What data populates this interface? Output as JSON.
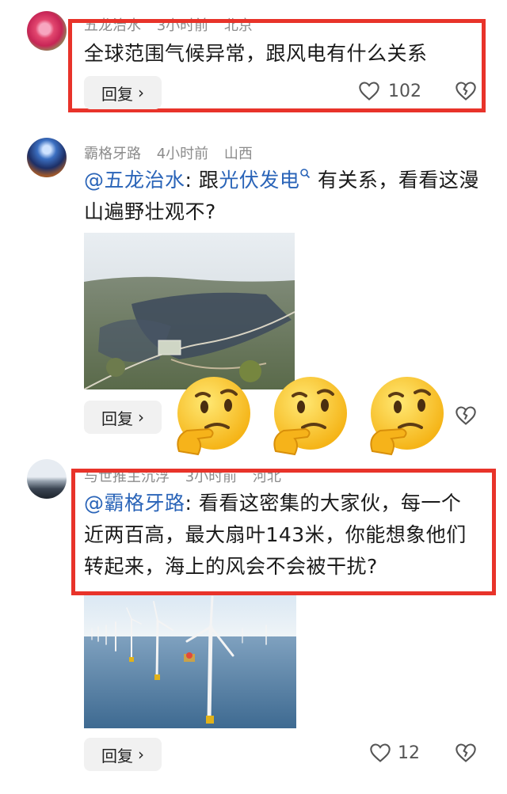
{
  "comments": [
    {
      "user": "五龙治水",
      "time": "3小时前",
      "location": "北京",
      "text": "全球范围气候异常，跟风电有什么关系",
      "reply_label": "回复",
      "likes": "102"
    },
    {
      "user": "霸格牙路",
      "time": "4小时前",
      "location": "山西",
      "mention": "@五龙治水",
      "text_pre": ": 跟",
      "link": "光伏发电",
      "text_post": " 有关系，看看这漫山遍野壮观不?",
      "reply_label": "回复"
    },
    {
      "user": "与世推主沉浮",
      "time": "3小时前",
      "location": "河北",
      "mention": "@霸格牙路",
      "text": ": 看看这密集的大家伙，每一个近两百高，最大扇叶143米，你能想象他们转起来，海上的风会不会被干扰?",
      "reply_label": "回复",
      "likes": "12"
    }
  ],
  "icons": {
    "heart": "heart-icon",
    "dislike": "broken-heart-icon",
    "chevron": "chevron-right-icon",
    "search": "search-icon",
    "emoji": "thinking-face-emoji"
  },
  "colors": {
    "highlight_box": "#e8332a",
    "mention": "#2a64b8",
    "meta": "#8c8c8c"
  }
}
